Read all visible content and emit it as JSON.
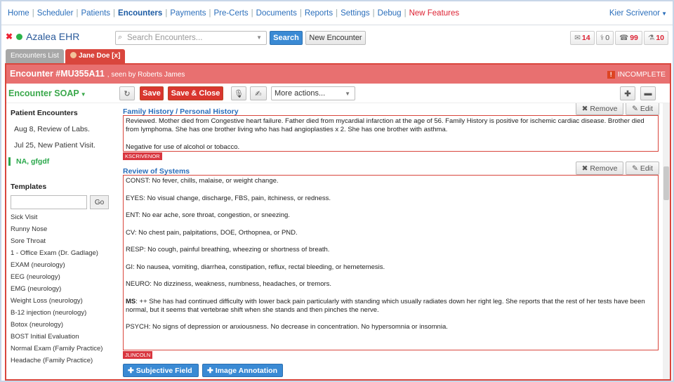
{
  "nav": {
    "links": [
      {
        "label": "Home",
        "active": false
      },
      {
        "label": "Scheduler",
        "active": false
      },
      {
        "label": "Patients",
        "active": false
      },
      {
        "label": "Encounters",
        "active": true
      },
      {
        "label": "Payments",
        "active": false
      },
      {
        "label": "Pre-Certs",
        "active": false
      },
      {
        "label": "Documents",
        "active": false
      },
      {
        "label": "Reports",
        "active": false
      },
      {
        "label": "Settings",
        "active": false
      },
      {
        "label": "Debug",
        "active": false
      },
      {
        "label": "New Features",
        "active": false
      }
    ],
    "user": "Kier Scrivenor"
  },
  "header": {
    "logo": "Azalea EHR",
    "search_placeholder": "Search Encounters...",
    "search_label": "Search",
    "new_encounter_label": "New Encounter",
    "badges": [
      {
        "icon": "inbox-icon",
        "count": "14"
      },
      {
        "icon": "pill-icon",
        "count": "0"
      },
      {
        "icon": "phone-icon",
        "count": "99"
      },
      {
        "icon": "flask-icon",
        "count": "10"
      }
    ]
  },
  "tabs": [
    "Encounters List",
    "Jane Doe [x]"
  ],
  "encounter": {
    "title": "Encounter #MU355A11",
    "seen_by": ", seen by Roberts James",
    "status": "INCOMPLETE"
  },
  "toolbar": {
    "soap_label": "Encounter SOAP",
    "save_label": "Save",
    "save_close_label": "Save & Close",
    "more_actions": "More actions..."
  },
  "sidebar": {
    "patient_encounters_title": "Patient Encounters",
    "encounters": [
      "Aug 8, Review of Labs.",
      "Jul 25, New Patient Visit.",
      "NA, gfgdf"
    ],
    "templates_title": "Templates",
    "go_label": "Go",
    "templates": [
      "Sick Visit",
      "Runny Nose",
      "Sore Throat",
      "1 - Office Exam (Dr. Gadlage)",
      "EXAM (neurology)",
      "EEG (neurology)",
      "EMG (neurology)",
      "Weight Loss (neurology)",
      "B-12 injection (neurology)",
      "Botox (neurology)",
      "BOST Initial Evaluation",
      "Normal Exam (Family Practice)",
      "Headache (Family Practice)"
    ]
  },
  "sections": {
    "family": {
      "title": "Family History / Personal History",
      "remove_label": "Remove",
      "edit_label": "Edit",
      "para1": "Reviewed. Mother died from Congestive heart failure. Father died from mycardial infarction at the age of 56. Family History is positive for ischemic cardiac disease. Brother died from lymphoma. She has one brother living who has had angioplasties x 2. She has one brother with asthma.",
      "para2": "Negative for use of alcohol or tobacco.",
      "author": "KSCRIVENOR"
    },
    "ros": {
      "title": "Review of Systems",
      "remove_label": "Remove",
      "edit_label": "Edit",
      "lines": [
        "CONST: No fever, chills, malaise, or weight change.",
        "EYES: No visual change, discharge, FBS, pain, itchiness, or redness.",
        "ENT: No ear ache, sore throat, congestion, or sneezing.",
        "CV: No chest pain, palpitations, DOE, Orthopnea, or PND.",
        "RESP: No cough, painful breathing, wheezing or shortness of breath.",
        "GI: No nausea, vomiting, diarrhea, constipation, reflux, rectal bleeding, or hemetemesis.",
        "NEURO: No dizziness, weakness, numbness, headaches, or tremors."
      ],
      "ms_label": "MS",
      "ms_text": ": ++ She has had continued difficulty with lower back pain particularly with standing which usually radiates down her right leg. She reports that the rest of her tests have been normal, but it seems that vertebrae shift when she stands and then pinches the nerve.",
      "psych": "PSYCH: No signs of depression or anxiousness. No decrease in concentration. No hypersomnia or insomnia.",
      "author": "JLINCOLN"
    }
  },
  "actions": {
    "subjective_field": "Subjective Field",
    "image_annotation": "Image Annotation"
  }
}
